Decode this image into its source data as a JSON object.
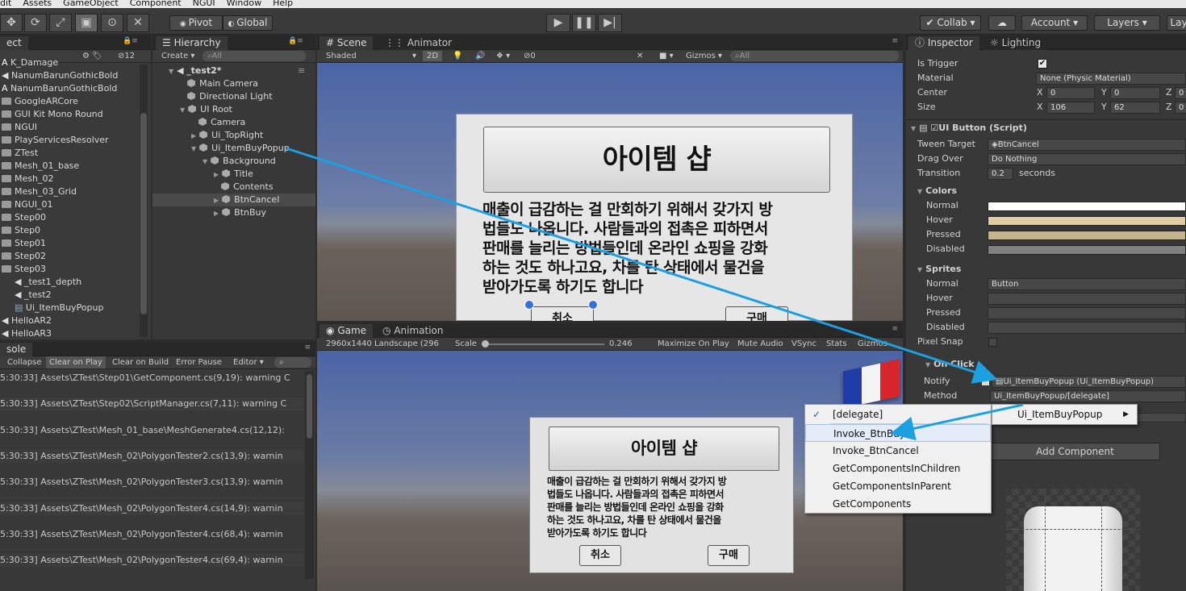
{
  "menubar": [
    "dit",
    "Assets",
    "GameObject",
    "Component",
    "NGUI",
    "Window",
    "Help"
  ],
  "toolbar": {
    "pivot": "Pivot",
    "global": "Global",
    "collab": "Collab",
    "account": "Account",
    "layers": "Layers",
    "layout": "Lay"
  },
  "project": {
    "tab": "ect",
    "count": "12",
    "items": [
      "K_Damage",
      "NanumBarunGothicBold",
      "NanumBarunGothicBold",
      "GoogleARCore",
      "GUI Kit Mono Round",
      "NGUI",
      "PlayServicesResolver",
      "ZTest",
      "Mesh_01_base",
      "Mesh_02",
      "Mesh_03_Grid",
      "NGUI_01",
      "Step00",
      "Step0",
      "Step01",
      "Step02",
      "Step03",
      "_test1_depth",
      "_test2",
      "Ui_ItemBuyPopup",
      "HelloAR2",
      "HelloAR3"
    ]
  },
  "hierarchy": {
    "tab": "Hierarchy",
    "create": "Create",
    "search": "All",
    "items": [
      "_test2*",
      "Main Camera",
      "Directional Light",
      "UI Root",
      "Camera",
      "Ui_TopRight",
      "Ui_ItemBuyPopup",
      "Background",
      "Title",
      "Contents",
      "BtnCancel",
      "BtnBuy"
    ]
  },
  "scene": {
    "tab_scene": "Scene",
    "tab_animator": "Animator",
    "shading": "Shaded",
    "mode2d": "2D",
    "fx_count": "0",
    "gizmos": "Gizmos",
    "search": "All",
    "title": "아이템 샵",
    "body_lines": [
      "매출이 급감하는 걸 만회하기 위해서 갖가지 방",
      "법들도 나옵니다. 사람들과의 접촉은 피하면서",
      "판매를 늘리는 방법들인데 온라인 쇼핑을 강화",
      "하는 것도 하나고요, 차를 탄 상태에서 물건을",
      "받아가도록 하기도 합니다"
    ],
    "cancel": "취소",
    "buy": "구매"
  },
  "game": {
    "tab_game": "Game",
    "tab_animation": "Animation",
    "resolution": "2960x1440 Landscape (296",
    "scale_label": "Scale",
    "scale_value": "0.246",
    "maximize": "Maximize On Play",
    "mute": "Mute Audio",
    "vsync": "VSync",
    "stats": "Stats",
    "gizmos": "Gizmos",
    "title": "아이템 샵",
    "body_lines": [
      "매출이 급감하는 걸 만회하기 위해서 갖가지 방",
      "법들도 나옵니다. 사람들과의 접촉은 피하면서",
      "판매를 늘리는 방법들인데 온라인 쇼핑을 강화",
      "하는 것도 하나고요, 차를 탄 상태에서 물건을",
      "받아가도록 하기도 합니다"
    ],
    "cancel": "취소",
    "buy": "구매"
  },
  "console": {
    "tab": "sole",
    "buttons": [
      "Collapse",
      "Clear on Play",
      "Clear on Build",
      "Error Pause",
      "Editor"
    ],
    "logs": [
      "5:30:33] Assets\\ZTest\\Step01\\GetComponent.cs(9,19): warning C",
      "5:30:33] Assets\\ZTest\\Step02\\ScriptManager.cs(7,11): warning C",
      "5:30:33] Assets\\ZTest\\Mesh_01_base\\MeshGenerate4.cs(12,12):",
      "5:30:33] Assets\\ZTest\\Mesh_02\\PolygonTester2.cs(13,9): warnin",
      "5:30:33] Assets\\ZTest\\Mesh_02\\PolygonTester3.cs(13,9): warnin",
      "5:30:33] Assets\\ZTest\\Mesh_02\\PolygonTester4.cs(14,9): warnin",
      "5:30:33] Assets\\ZTest\\Mesh_02\\PolygonTester4.cs(68,4): warnin",
      "5:30:33] Assets\\ZTest\\Mesh_02\\PolygonTester4.cs(69,4): warnin"
    ]
  },
  "inspector": {
    "tab_inspector": "Inspector",
    "tab_lighting": "Lighting",
    "is_trigger": "Is Trigger",
    "material_label": "Material",
    "material_value": "None (Physic Material)",
    "center_label": "Center",
    "center": {
      "x": "0",
      "y": "0",
      "z": "0"
    },
    "size_label": "Size",
    "size": {
      "x": "106",
      "y": "62",
      "z": "0"
    },
    "component": "UI Button (Script)",
    "tween_label": "Tween Target",
    "tween_value": "BtnCancel",
    "drag_label": "Drag Over",
    "drag_value": "Do Nothing",
    "transition_label": "Transition",
    "transition_value": "0.2",
    "seconds": "seconds",
    "colors_header": "Colors",
    "color_rows": [
      "Normal",
      "Hover",
      "Pressed",
      "Disabled"
    ],
    "sprites_header": "Sprites",
    "sprite_rows": [
      "Normal",
      "Hover",
      "Pressed",
      "Disabled"
    ],
    "sprite_normal_value": "Button",
    "pixel_snap": "Pixel Snap",
    "onclick": "On Click",
    "notify_label": "Notify",
    "notify_value": "Ui_ItemBuyPopup (Ui_ItemBuyPopup)",
    "method_label": "Method",
    "method_value": "Ui_ItemBuyPopup/[delegate]",
    "add_component": "Add Component",
    "colors": {
      "normal": "#ffffff",
      "hover": "#e1cda4",
      "pressed": "#c8b48c",
      "disabled": "#808080"
    }
  },
  "dropdown": {
    "items": [
      "[delegate]",
      "Invoke_BtnBuy",
      "Invoke_BtnCancel",
      "GetComponentsInChildren",
      "GetComponentsInParent",
      "GetComponents"
    ],
    "submenu": "Ui_ItemBuyPopup",
    "checked": "✓"
  }
}
